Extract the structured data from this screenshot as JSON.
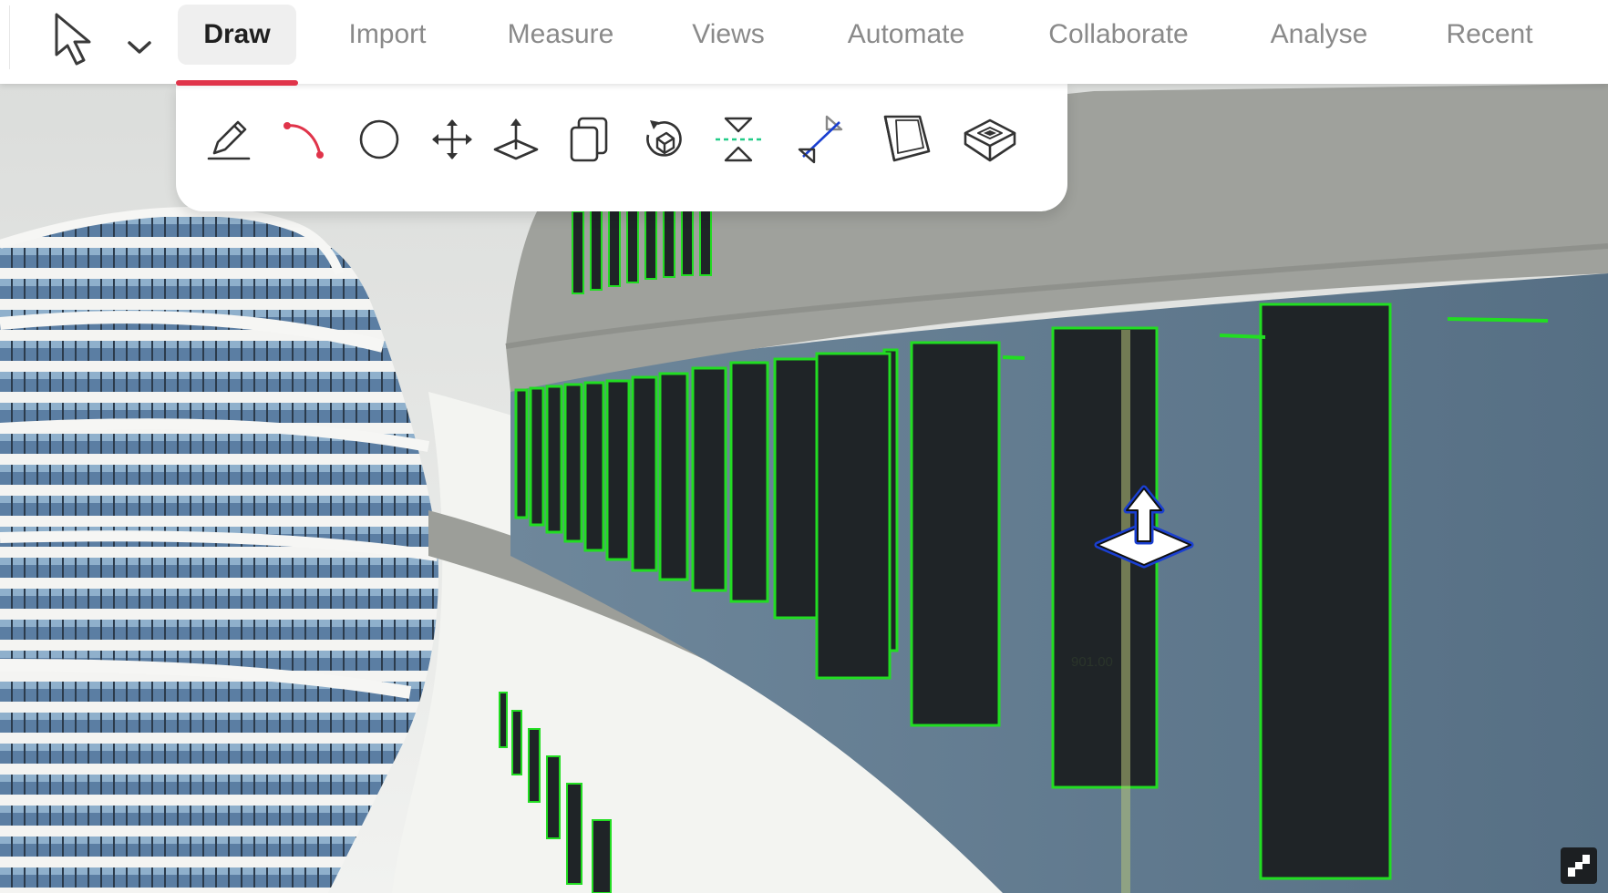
{
  "app": {
    "menu": {
      "tabs": [
        {
          "label": "Draw",
          "active": true
        },
        {
          "label": "Import",
          "active": false
        },
        {
          "label": "Measure",
          "active": false
        },
        {
          "label": "Views",
          "active": false
        },
        {
          "label": "Automate",
          "active": false
        },
        {
          "label": "Collaborate",
          "active": false
        },
        {
          "label": "Analyse",
          "active": false
        },
        {
          "label": "Recent",
          "active": false
        }
      ],
      "select_tool_icon": "cursor-arrow-icon",
      "select_tool_dropdown_icon": "chevron-down-icon"
    },
    "draw_toolbar": {
      "tools": [
        {
          "icon": "pencil-icon"
        },
        {
          "icon": "arc-icon"
        },
        {
          "icon": "circle-icon"
        },
        {
          "icon": "move-icon"
        },
        {
          "icon": "push-pull-icon"
        },
        {
          "icon": "copy-icon"
        },
        {
          "icon": "rotate-icon"
        },
        {
          "icon": "flip-icon"
        },
        {
          "icon": "mirror-icon"
        },
        {
          "icon": "offset-icon"
        },
        {
          "icon": "solid-icon"
        }
      ]
    },
    "viewport": {
      "dimension_label": "901.00",
      "gizmo_icon": "move-gizmo-icon",
      "logo_icon": "app-logo-icon"
    },
    "colors": {
      "accent": "#e0344a",
      "selection_outline": "#22dd22",
      "gizmo_outline": "#1a3fd0",
      "glass": "#5f7890",
      "mullion": "#1f2427"
    }
  }
}
